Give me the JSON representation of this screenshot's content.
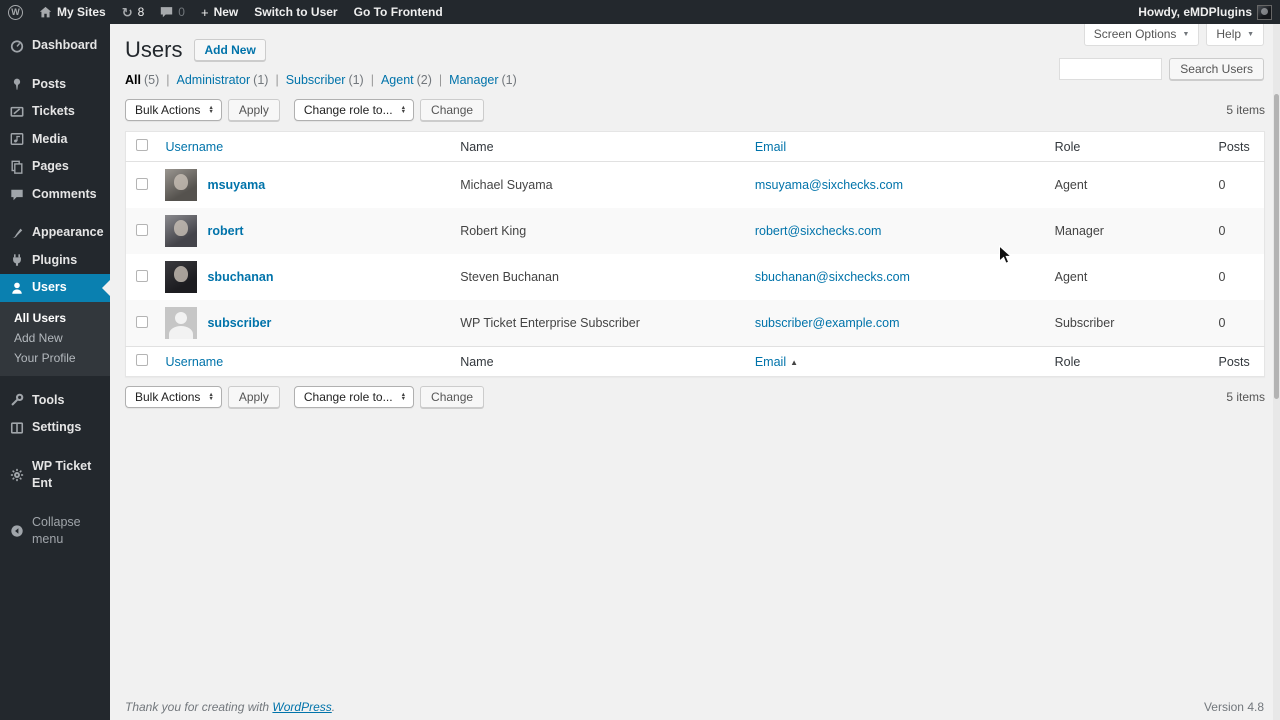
{
  "admin_bar": {
    "my_sites_label": "My Sites",
    "updates_count": "8",
    "comments_count": "0",
    "new_label": "New",
    "switch_to_user_label": "Switch to User",
    "go_to_frontend_label": "Go To Frontend",
    "howdy_text": "Howdy, eMDPlugins"
  },
  "sidebar": {
    "items": [
      "Dashboard",
      "Posts",
      "Tickets",
      "Media",
      "Pages",
      "Comments",
      "Appearance",
      "Plugins",
      "Users",
      "Tools",
      "Settings",
      "WP Ticket Ent",
      "Collapse menu"
    ],
    "users_submenu": [
      "All Users",
      "Add New",
      "Your Profile"
    ]
  },
  "page": {
    "title": "Users",
    "add_new_button": "Add New",
    "screen_options_label": "Screen Options",
    "help_label": "Help",
    "search_value": "",
    "search_button": "Search Users",
    "items_count": "5 items",
    "filter_separator": "|",
    "filters": [
      {
        "label": "All",
        "count": "(5)"
      },
      {
        "label": "Administrator",
        "count": "(1)"
      },
      {
        "label": "Subscriber",
        "count": "(1)"
      },
      {
        "label": "Agent",
        "count": "(2)"
      },
      {
        "label": "Manager",
        "count": "(1)"
      }
    ],
    "toolbar": {
      "bulk_actions": "Bulk Actions",
      "apply": "Apply",
      "change_role": "Change role to...",
      "change": "Change"
    }
  },
  "table": {
    "headers": {
      "username": "Username",
      "name": "Name",
      "email": "Email",
      "role": "Role",
      "posts": "Posts"
    },
    "rows": [
      {
        "username": "msuyama",
        "name": "Michael Suyama",
        "email": "msuyama@sixchecks.com",
        "role": "Agent",
        "posts": "0"
      },
      {
        "username": "robert",
        "name": "Robert King",
        "email": "robert@sixchecks.com",
        "role": "Manager",
        "posts": "0"
      },
      {
        "username": "sbuchanan",
        "name": "Steven Buchanan",
        "email": "sbuchanan@sixchecks.com",
        "role": "Agent",
        "posts": "0"
      },
      {
        "username": "subscriber",
        "name": "WP Ticket Enterprise Subscriber",
        "email": "subscriber@example.com",
        "role": "Subscriber",
        "posts": "0"
      }
    ]
  },
  "footer": {
    "thanks_prefix": "Thank you for creating with",
    "wordpress_link": "WordPress",
    "suffix": ".",
    "version": "Version 4.8"
  },
  "icons": {
    "wp_logo_letter": "W",
    "caret_down": "▼",
    "sort_ascending": "▲",
    "select_up": "▲",
    "select_down": "▼",
    "plus": "+",
    "updates": "↻"
  },
  "colors": {
    "admin_bar_bg": "#23282d",
    "menu_highlight": "#0a80b0",
    "accent_link": "#0073aa",
    "content_bg": "#f1f1f1",
    "alt_row_bg": "#f9f9f9"
  }
}
